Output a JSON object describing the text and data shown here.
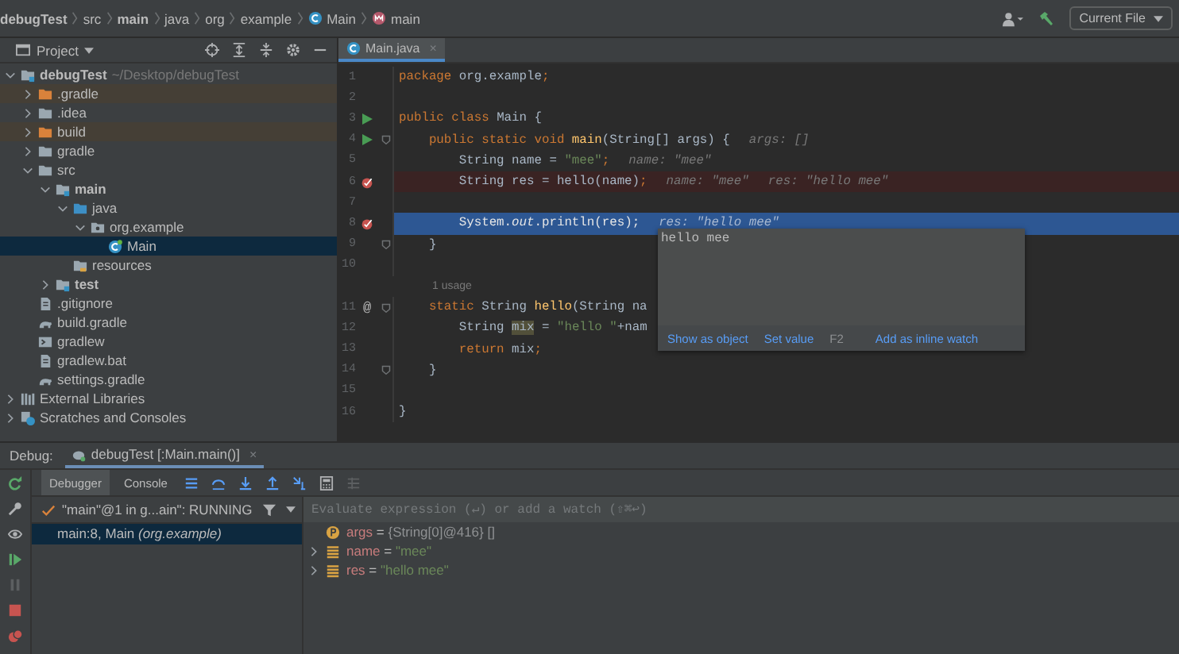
{
  "breadcrumbs": [
    {
      "text": "debugTest",
      "bold": true
    },
    {
      "text": "src",
      "bold": false
    },
    {
      "text": "main",
      "bold": true
    },
    {
      "text": "java",
      "bold": false
    },
    {
      "text": "org",
      "bold": false
    },
    {
      "text": "example",
      "bold": false
    },
    {
      "text": "Main",
      "kind": "class",
      "bold": false
    },
    {
      "text": "main",
      "kind": "method",
      "bold": false
    }
  ],
  "run_config": "Current File",
  "project_panel": {
    "title": "Project",
    "tree": [
      {
        "label": "debugTest",
        "kind": "module",
        "path": "~/Desktop/debugTest",
        "expanded": true,
        "selected": false,
        "children": [
          {
            "label": ".gradle",
            "kind": "excluded",
            "expanded": false,
            "selected": false
          },
          {
            "label": ".idea",
            "kind": "folder",
            "expanded": false,
            "selected": false
          },
          {
            "label": "build",
            "kind": "excluded",
            "expanded": false,
            "selected": false
          },
          {
            "label": "gradle",
            "kind": "folder",
            "expanded": false,
            "selected": false
          },
          {
            "label": "src",
            "kind": "folder",
            "expanded": true,
            "selected": false,
            "children": [
              {
                "label": "main",
                "kind": "module",
                "expanded": true,
                "selected": false,
                "children": [
                  {
                    "label": "java",
                    "kind": "source",
                    "expanded": true,
                    "selected": false,
                    "children": [
                      {
                        "label": "org.example",
                        "kind": "package",
                        "expanded": true,
                        "selected": false,
                        "children": [
                          {
                            "label": "Main",
                            "kind": "class",
                            "selected": true
                          }
                        ]
                      }
                    ]
                  },
                  {
                    "label": "resources",
                    "kind": "resources",
                    "selected": false
                  }
                ]
              },
              {
                "label": "test",
                "kind": "module",
                "expanded": false,
                "selected": false
              }
            ]
          },
          {
            "label": ".gitignore",
            "kind": "file",
            "selected": false
          },
          {
            "label": "build.gradle",
            "kind": "gradle",
            "selected": false
          },
          {
            "label": "gradlew",
            "kind": "terminal",
            "selected": false
          },
          {
            "label": "gradlew.bat",
            "kind": "file",
            "selected": false
          },
          {
            "label": "settings.gradle",
            "kind": "gradle",
            "selected": false
          }
        ]
      },
      {
        "label": "External Libraries",
        "kind": "libraries",
        "expanded": false,
        "selected": false
      },
      {
        "label": "Scratches and Consoles",
        "kind": "scratches",
        "expanded": false,
        "selected": false
      }
    ]
  },
  "editor": {
    "tabs": [
      {
        "label": "Main.java",
        "close": "×",
        "selected": true
      }
    ],
    "lines": [
      {
        "kind": "code",
        "number": "1",
        "run": false,
        "breakpoint": false,
        "current": false,
        "fold": false,
        "tokens": [
          {
            "kind": "keyword",
            "text": "package"
          },
          {
            "kind": "plain",
            "text": " org.example"
          },
          {
            "kind": "keyword",
            "text": ";"
          }
        ]
      },
      {
        "kind": "code",
        "number": "2",
        "run": false,
        "breakpoint": false,
        "current": false,
        "fold": false
      },
      {
        "kind": "code",
        "number": "3",
        "run": true,
        "breakpoint": false,
        "current": false,
        "fold": false,
        "tokens": [
          {
            "kind": "keyword",
            "text": "public class"
          },
          {
            "kind": "plain",
            "text": " Main {"
          }
        ]
      },
      {
        "kind": "code",
        "number": "4",
        "run": true,
        "breakpoint": false,
        "current": false,
        "fold": true,
        "tokens": [
          {
            "kind": "keyword",
            "text": "    public static void "
          },
          {
            "kind": "declaration",
            "text": "main"
          },
          {
            "kind": "plain",
            "text": "(String[] args) {"
          },
          {
            "kind": "hint",
            "text": "args: []"
          }
        ]
      },
      {
        "kind": "code",
        "number": "5",
        "run": false,
        "breakpoint": false,
        "current": false,
        "fold": false,
        "tokens": [
          {
            "kind": "plain",
            "text": "        String name = "
          },
          {
            "kind": "string",
            "text": "\"mee\""
          },
          {
            "kind": "keyword",
            "text": ";"
          },
          {
            "kind": "hint",
            "text": "name: \"mee\""
          }
        ]
      },
      {
        "kind": "code",
        "number": "6",
        "run": false,
        "breakpoint": true,
        "current": false,
        "fold": false,
        "tokens": [
          {
            "kind": "plain",
            "text": "        String res = hello(name)"
          },
          {
            "kind": "keyword",
            "text": ";"
          },
          {
            "kind": "hint",
            "text": "name: \"mee\""
          },
          {
            "kind": "hint",
            "text": "res: \"hello mee\""
          }
        ]
      },
      {
        "kind": "code",
        "number": "7",
        "run": false,
        "breakpoint": false,
        "current": false,
        "fold": false
      },
      {
        "kind": "code",
        "number": "8",
        "run": false,
        "breakpoint": true,
        "current": true,
        "fold": false,
        "tokens": [
          {
            "kind": "plain",
            "text": "        System."
          },
          {
            "kind": "static-field",
            "text": "out"
          },
          {
            "kind": "plain",
            "text": ".println(res)"
          },
          {
            "kind": "keyword",
            "text": ";"
          },
          {
            "kind": "hint",
            "text": "res: \"hello mee\""
          }
        ]
      },
      {
        "kind": "code",
        "number": "9",
        "run": false,
        "breakpoint": false,
        "current": false,
        "fold": true,
        "tokens": [
          {
            "kind": "plain",
            "text": "    }"
          }
        ]
      },
      {
        "kind": "code",
        "number": "10",
        "run": false,
        "breakpoint": false,
        "current": false,
        "fold": false
      },
      {
        "kind": "usage",
        "text": "1 usage"
      },
      {
        "kind": "code",
        "number": "11",
        "gutter_text": "@",
        "run": false,
        "breakpoint": false,
        "current": false,
        "fold": true,
        "tokens": [
          {
            "kind": "keyword",
            "text": "    static"
          },
          {
            "kind": "plain",
            "text": " String "
          },
          {
            "kind": "declaration",
            "text": "hello"
          },
          {
            "kind": "plain",
            "text": "(String na"
          }
        ]
      },
      {
        "kind": "code",
        "number": "12",
        "run": false,
        "breakpoint": false,
        "current": false,
        "fold": false,
        "tokens": [
          {
            "kind": "plain",
            "text": "        String "
          },
          {
            "kind": "usage-highlight",
            "text": "mix"
          },
          {
            "kind": "plain",
            "text": " = "
          },
          {
            "kind": "string",
            "text": "\"hello \""
          },
          {
            "kind": "plain",
            "text": "+nam"
          }
        ]
      },
      {
        "kind": "code",
        "number": "13",
        "run": false,
        "breakpoint": false,
        "current": false,
        "fold": false,
        "tokens": [
          {
            "kind": "keyword",
            "text": "        return"
          },
          {
            "kind": "plain",
            "text": " mix"
          },
          {
            "kind": "keyword",
            "text": ";"
          }
        ]
      },
      {
        "kind": "code",
        "number": "14",
        "run": false,
        "breakpoint": false,
        "current": false,
        "fold": true,
        "tokens": [
          {
            "kind": "plain",
            "text": "    }"
          }
        ]
      },
      {
        "kind": "code",
        "number": "15",
        "run": false,
        "breakpoint": false,
        "current": false,
        "fold": false
      },
      {
        "kind": "code",
        "number": "16",
        "run": false,
        "breakpoint": false,
        "current": false,
        "fold": false,
        "tokens": [
          {
            "kind": "plain",
            "text": "}"
          }
        ]
      }
    ],
    "popup": {
      "value": "hello mee",
      "actions": [
        {
          "label": "Show as object"
        },
        {
          "label": "Set value",
          "shortcut": "F2"
        },
        {
          "label": "Add as inline watch"
        }
      ]
    }
  },
  "debug_panel": {
    "title": "Debug:",
    "sessions": [
      {
        "label": "debugTest [:Main.main()]",
        "close": "×",
        "selected": true
      }
    ],
    "tabs": [
      {
        "label": "Debugger",
        "selected": true
      },
      {
        "label": "Console",
        "selected": false
      }
    ],
    "thread": "\"main\"@1 in g...ain\": RUNNING",
    "frames": [
      {
        "text": "main:8, Main *(org.example)*",
        "selected": true
      }
    ],
    "evaluate_placeholder": "Evaluate expression (↵) or add a watch (⇧⌘↩)",
    "variables": [
      {
        "kind": "parameter",
        "name": "args",
        "operator": "=",
        "value": "{String[0]@416} []"
      },
      {
        "kind": "field",
        "name": "name",
        "operator": "=",
        "value": "\"mee\"",
        "expanded": false
      },
      {
        "kind": "field",
        "name": "res",
        "operator": "=",
        "value": "\"hello mee\"",
        "expanded": false
      }
    ]
  }
}
